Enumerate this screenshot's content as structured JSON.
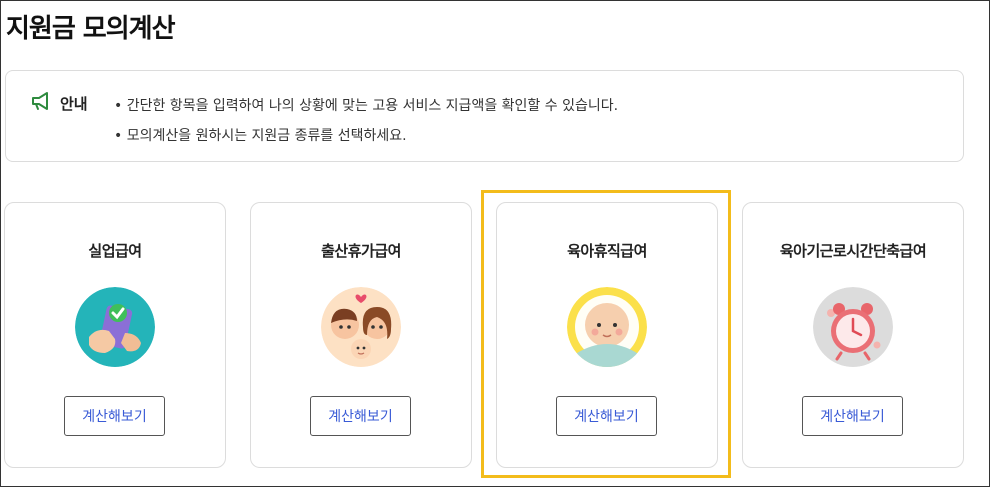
{
  "page": {
    "title": "지원금 모의계산"
  },
  "notice": {
    "label": "안내",
    "icon": "megaphone-icon",
    "lines": [
      "간단한 항목을 입력하여 나의 상황에 맞는 고용 서비스 지급액을 확인할 수 있습니다.",
      "모의계산을 원하시는 지원금 종류를 선택하세요."
    ]
  },
  "cards": [
    {
      "title": "실업급여",
      "button": "계산해보기",
      "illustration": "hand-phone-check-icon"
    },
    {
      "title": "출산휴가급여",
      "button": "계산해보기",
      "illustration": "parents-baby-icon"
    },
    {
      "title": "육아휴직급여",
      "button": "계산해보기",
      "illustration": "baby-face-icon"
    },
    {
      "title": "육아기근로시간단축급여",
      "button": "계산해보기",
      "illustration": "alarm-clock-icon"
    }
  ],
  "colors": {
    "highlight": "#f3bc1b",
    "button_text": "#3a5bd6",
    "accent_green": "#2e8b3e"
  },
  "selected_card": "육아휴직급여"
}
